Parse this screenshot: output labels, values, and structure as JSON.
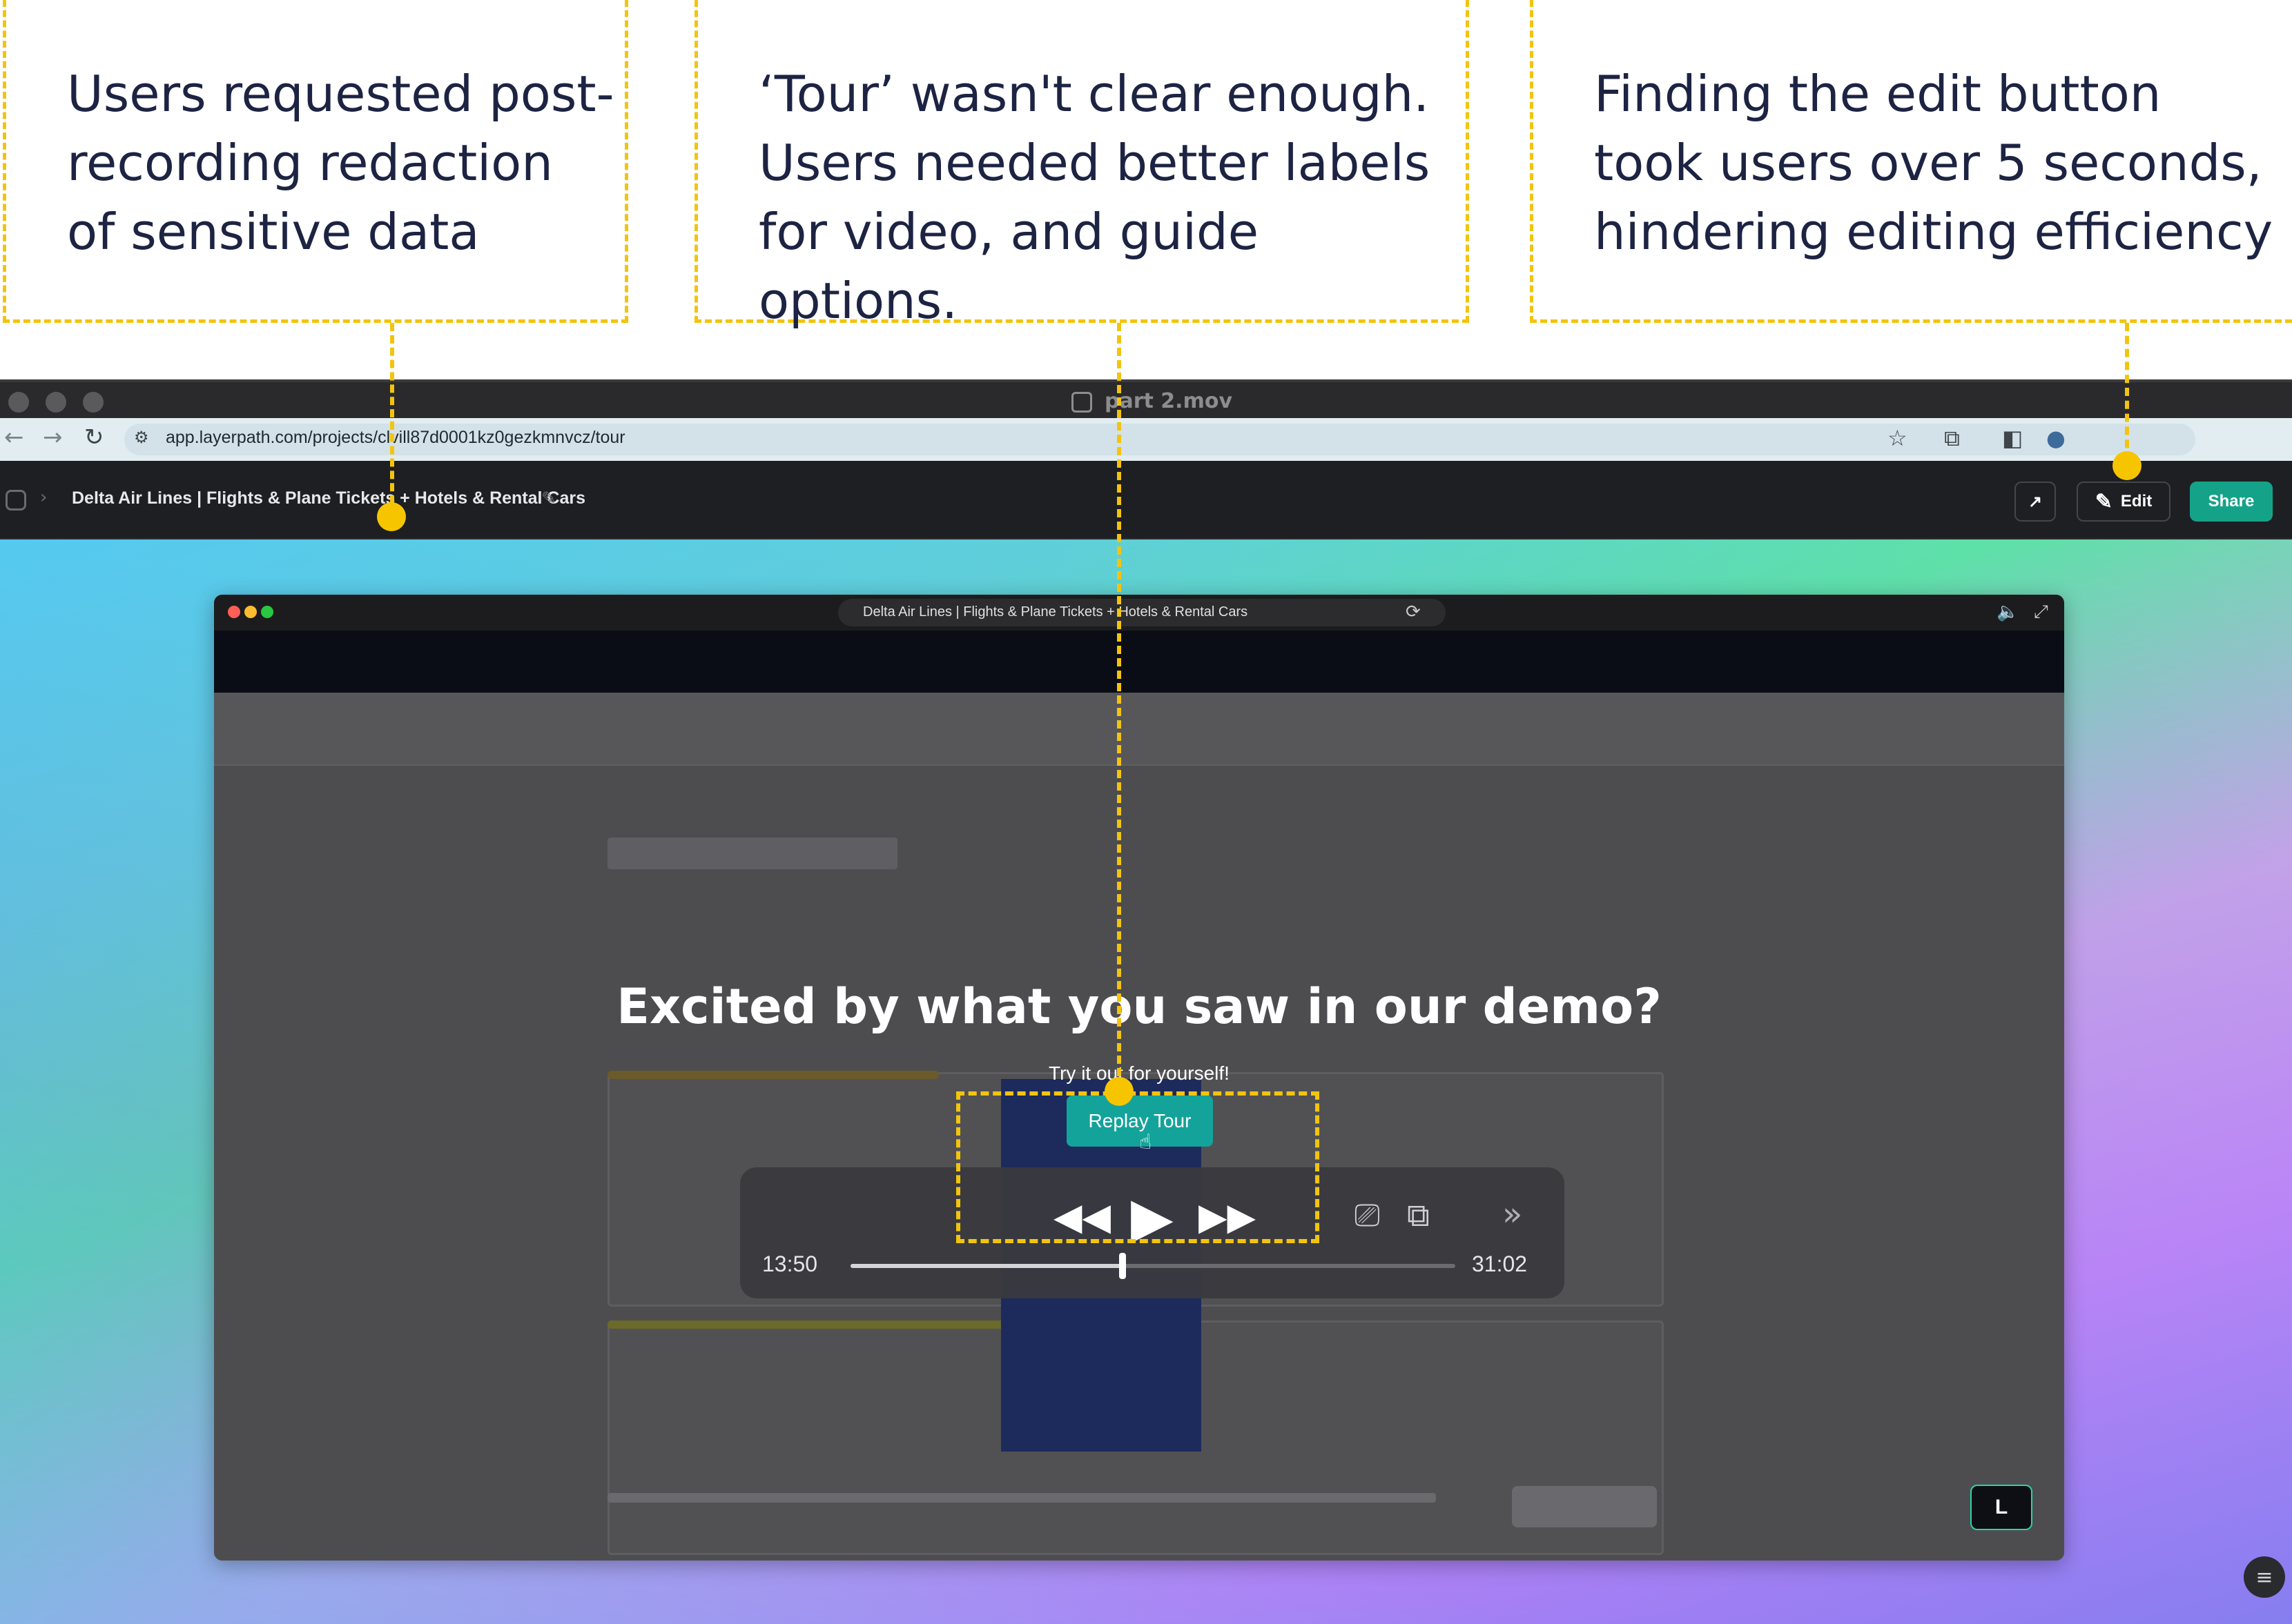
{
  "annotations": [
    {
      "text": "Users requested post-\nrecording redaction\nof sensitive data"
    },
    {
      "text": "‘Tour’ wasn't clear enough.\nUsers needed better labels\nfor video, and guide options."
    },
    {
      "text": "Finding the edit button\ntook users over 5 seconds,\nhindering editing efficiency"
    }
  ],
  "window": {
    "title": "part 2.mov"
  },
  "browser": {
    "url": "app.layerpath.com/projects/clvill87d0001kz0gezkmnvcz/tour"
  },
  "app_header": {
    "project_title": "Delta Air Lines | Flights & Plane Tickets + Hotels & Rental Cars",
    "edit_label": "Edit",
    "share_label": "Share"
  },
  "demo": {
    "tab_title": "Delta Air Lines | Flights & Plane Tickets + Hotels & Rental Cars",
    "heading": "Excited by what you saw in our demo?",
    "subheading": "Try it out for yourself!",
    "replay_label": "Replay Tour",
    "badge": "L"
  },
  "player": {
    "elapsed": "13:50",
    "remaining": "31:02",
    "progress": 0.45
  },
  "colors": {
    "annotation_accent": "#f2c40f",
    "share_button": "#14a388",
    "replay_button": "#14a39a"
  },
  "icons": [
    "back-arrow-icon",
    "forward-arrow-icon",
    "reload-icon",
    "site-settings-icon",
    "star-icon",
    "extensions-icon",
    "sidebar-icon",
    "profile-icon",
    "home-icon",
    "pencil-icon",
    "analytics-icon",
    "edit-icon",
    "refresh-icon",
    "volume-icon",
    "expand-icon",
    "rewind-icon",
    "play-icon",
    "fast-forward-icon",
    "airplay-icon",
    "pip-icon",
    "more-icon",
    "cursor-icon",
    "help-icon"
  ]
}
